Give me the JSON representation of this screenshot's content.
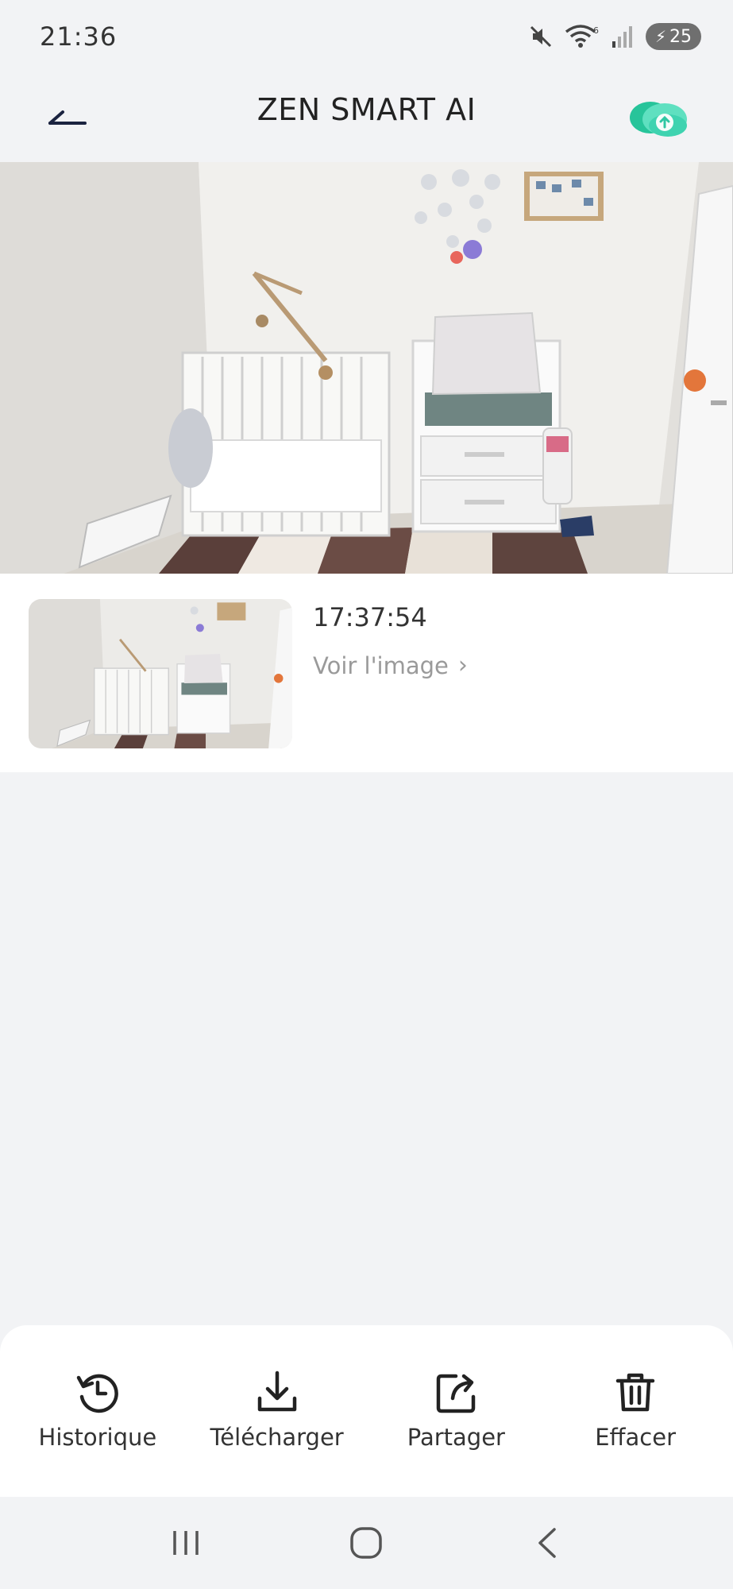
{
  "status_bar": {
    "time": "21:36",
    "battery": "25",
    "icons": [
      "mute-icon",
      "wifi-icon",
      "signal-icon",
      "battery-icon"
    ]
  },
  "header": {
    "title": "ZEN SMART AI",
    "back_icon": "back-arrow-icon",
    "cloud_icon": "cloud-upload-icon",
    "accent_color": "#2fc7a3"
  },
  "snapshot": {
    "description_icon": "camera-snapshot-image"
  },
  "event": {
    "time": "17:37:54",
    "link_label": "Voir l'image"
  },
  "actions": [
    {
      "label": "Historique",
      "icon": "history-icon"
    },
    {
      "label": "Télécharger",
      "icon": "download-icon"
    },
    {
      "label": "Partager",
      "icon": "share-icon"
    },
    {
      "label": "Effacer",
      "icon": "trash-icon"
    }
  ],
  "nav": {
    "recents_icon": "recents-icon",
    "home_icon": "home-icon",
    "back_icon": "system-back-icon"
  }
}
